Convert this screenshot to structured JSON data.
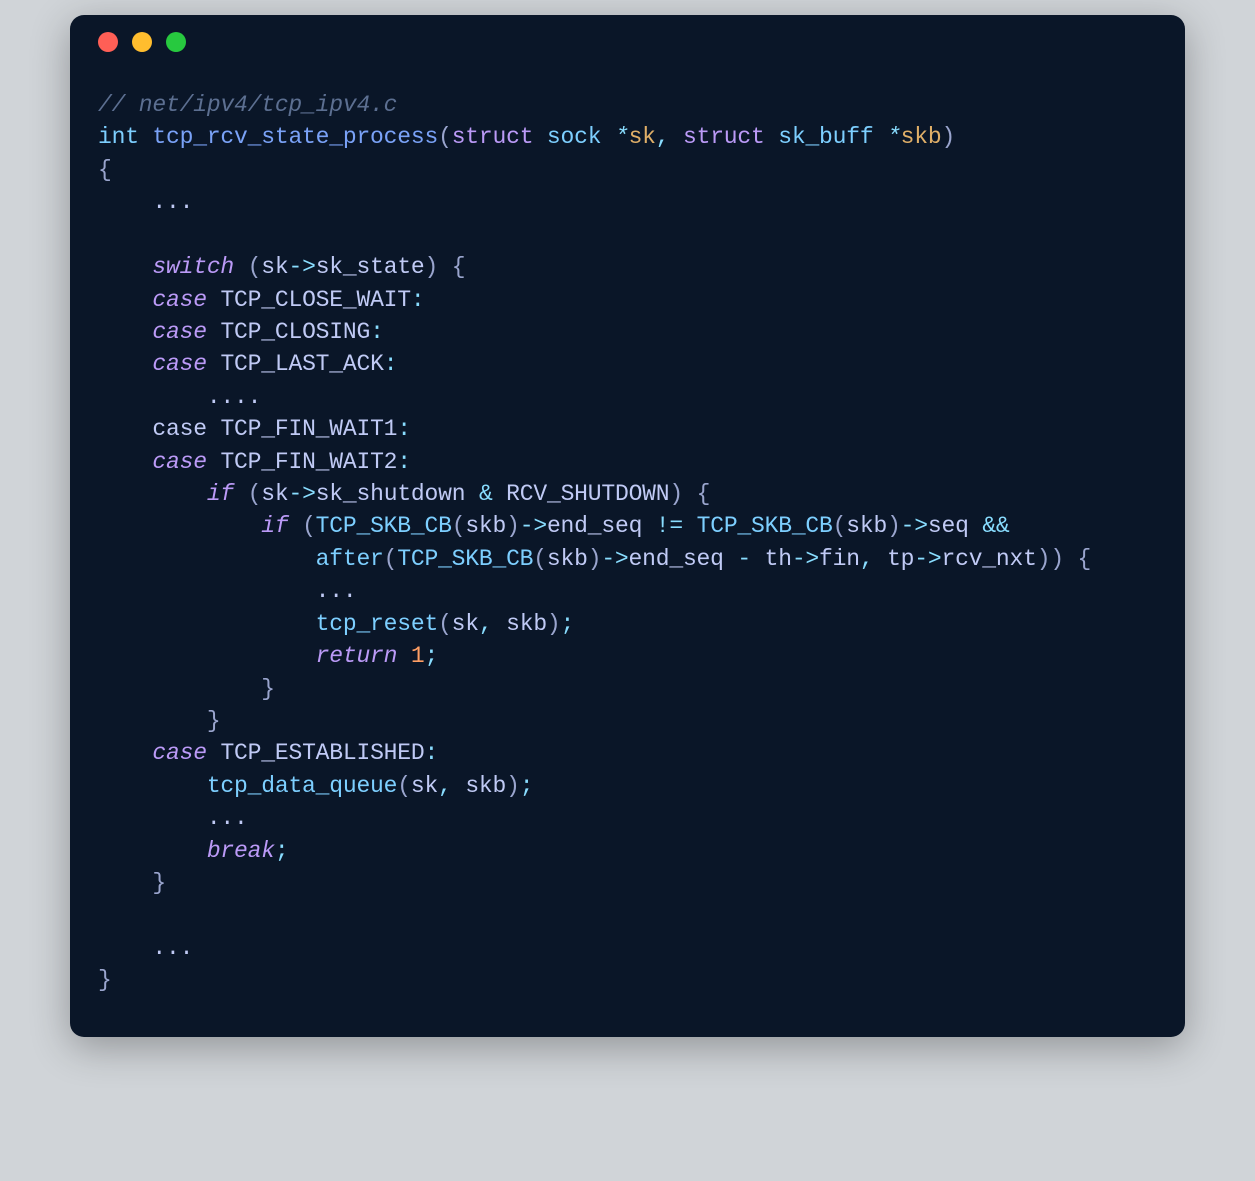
{
  "code": {
    "comment": "// net/ipv4/tcp_ipv4.c",
    "line2": {
      "int": "int",
      "fn": "tcp_rcv_state_process",
      "struct1": "struct",
      "sock": "sock",
      "sk": "sk",
      "struct2": "struct",
      "skbuff": "sk_buff",
      "skb": "skb"
    },
    "ellipsis1": "...",
    "switch_kw": "switch",
    "sk_var": "sk",
    "sk_state": "sk_state",
    "case1": "case",
    "tcp_close_wait": "TCP_CLOSE_WAIT",
    "case2": "case",
    "tcp_closing": "TCP_CLOSING",
    "case3": "case",
    "tcp_last_ack": "TCP_LAST_ACK",
    "ellipsis2": "....",
    "case4": "case",
    "tcp_fin_wait1": "TCP_FIN_WAIT1",
    "case5": "case",
    "tcp_fin_wait2": "TCP_FIN_WAIT2",
    "if1": "if",
    "sk_shutdown": "sk_shutdown",
    "rcv_shutdown": "RCV_SHUTDOWN",
    "if2": "if",
    "tcp_skb_cb1": "TCP_SKB_CB",
    "end_seq1": "end_seq",
    "tcp_skb_cb2": "TCP_SKB_CB",
    "seq": "seq",
    "after": "after",
    "tcp_skb_cb3": "TCP_SKB_CB",
    "end_seq2": "end_seq",
    "th": "th",
    "fin": "fin",
    "tp": "tp",
    "rcv_nxt": "rcv_nxt",
    "ellipsis3": "...",
    "tcp_reset": "tcp_reset",
    "return_kw": "return",
    "one": "1",
    "case6": "case",
    "tcp_established": "TCP_ESTABLISHED",
    "tcp_data_queue": "tcp_data_queue",
    "ellipsis4": "...",
    "break_kw": "break",
    "ellipsis5": "...",
    "skb_var": "skb"
  }
}
